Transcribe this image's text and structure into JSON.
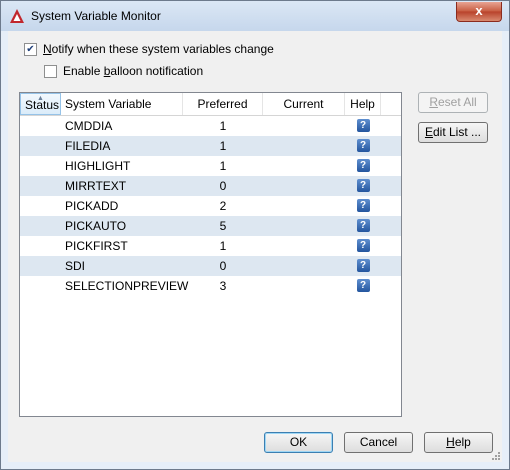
{
  "window": {
    "title": "System Variable Monitor",
    "close_glyph": "x"
  },
  "options": {
    "notify": {
      "prefix": "",
      "accel": "N",
      "suffix": "otify when these system variables change",
      "checked": true
    },
    "balloon": {
      "prefix": "Enable ",
      "accel": "b",
      "suffix": "alloon notification",
      "checked": false
    }
  },
  "table": {
    "columns": [
      "Status",
      "System Variable",
      "Preferred",
      "Current",
      "Help"
    ],
    "rows": [
      {
        "name": "CMDDIA",
        "preferred": "1",
        "current": ""
      },
      {
        "name": "FILEDIA",
        "preferred": "1",
        "current": ""
      },
      {
        "name": "HIGHLIGHT",
        "preferred": "1",
        "current": ""
      },
      {
        "name": "MIRRTEXT",
        "preferred": "0",
        "current": ""
      },
      {
        "name": "PICKADD",
        "preferred": "2",
        "current": ""
      },
      {
        "name": "PICKAUTO",
        "preferred": "5",
        "current": ""
      },
      {
        "name": "PICKFIRST",
        "preferred": "1",
        "current": ""
      },
      {
        "name": "SDI",
        "preferred": "0",
        "current": ""
      },
      {
        "name": "SELECTIONPREVIEW",
        "preferred": "3",
        "current": ""
      }
    ],
    "help_glyph": "?"
  },
  "buttons": {
    "reset_all": {
      "accel": "R",
      "rest": "eset All",
      "enabled": false
    },
    "edit_list": {
      "accel": "E",
      "rest": "dit List ..."
    },
    "ok": "OK",
    "cancel": "Cancel",
    "help": {
      "accel": "H",
      "rest": "elp"
    }
  },
  "colors": {
    "accent_red": "#c1272d",
    "alt_row": "#dde7f1",
    "help_blue": "#24569e"
  }
}
